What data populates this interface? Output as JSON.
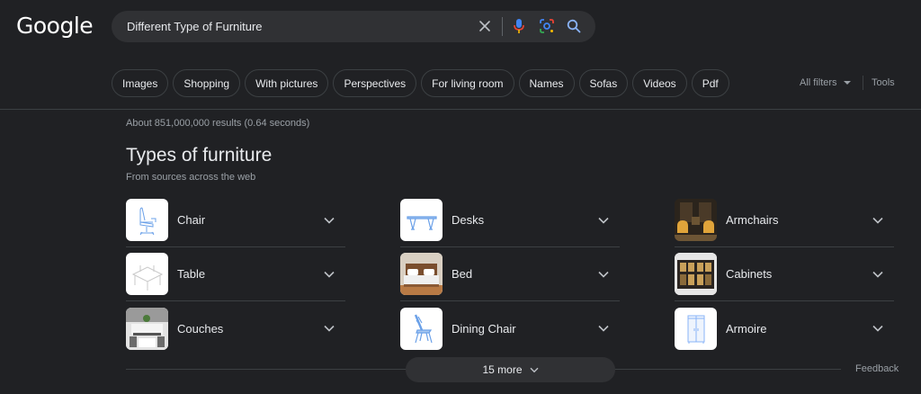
{
  "logo": "Google",
  "search": {
    "query": "Different Type of Furniture"
  },
  "chips": [
    "Images",
    "Shopping",
    "With pictures",
    "Perspectives",
    "For living room",
    "Names",
    "Sofas",
    "Videos",
    "Pdf"
  ],
  "filters": {
    "all_filters": "All filters",
    "tools": "Tools"
  },
  "stats": "About 851,000,000 results (0.64 seconds)",
  "section": {
    "title": "Types of furniture",
    "subtitle": "From sources across the web"
  },
  "items": [
    {
      "label": "Chair",
      "icon": "chair-icon"
    },
    {
      "label": "Desks",
      "icon": "desk-icon"
    },
    {
      "label": "Armchairs",
      "icon": "armchairs-icon"
    },
    {
      "label": "Table",
      "icon": "table-icon"
    },
    {
      "label": "Bed",
      "icon": "bed-icon"
    },
    {
      "label": "Cabinets",
      "icon": "cabinets-icon"
    },
    {
      "label": "Couches",
      "icon": "couches-icon"
    },
    {
      "label": "Dining Chair",
      "icon": "dining-chair-icon"
    },
    {
      "label": "Armoire",
      "icon": "armoire-icon"
    }
  ],
  "more_button": "15 more",
  "feedback": "Feedback",
  "colors": {
    "background": "#202124",
    "surface": "#303134",
    "text": "#e8eaed",
    "muted": "#9aa0a6",
    "border": "#3c4043",
    "accent_blue": "#8ab4f8"
  }
}
